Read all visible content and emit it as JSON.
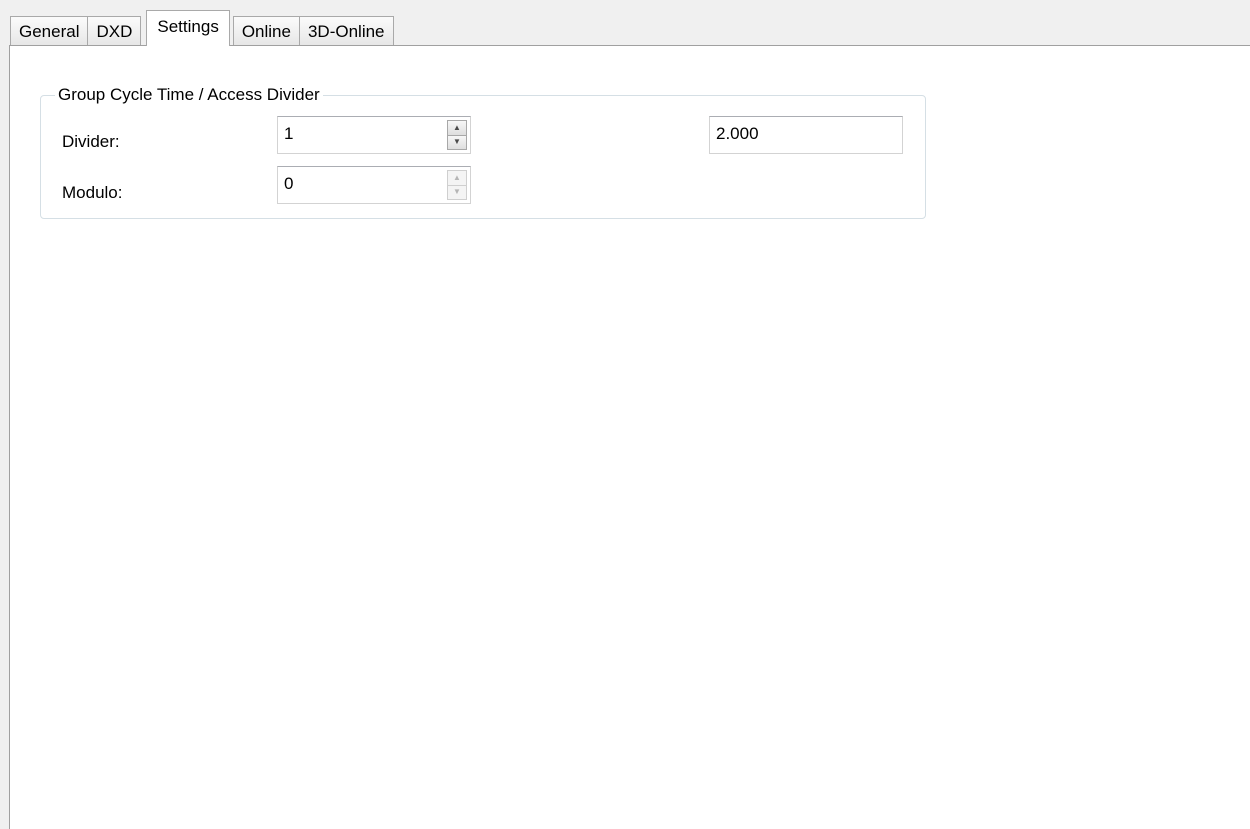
{
  "tabs": [
    {
      "label": "General",
      "active": false
    },
    {
      "label": "DXD",
      "active": false
    },
    {
      "label": "Settings",
      "active": true
    },
    {
      "label": "Online",
      "active": false
    },
    {
      "label": "3D-Online",
      "active": false
    }
  ],
  "group": {
    "title": "Group Cycle Time / Access Divider",
    "divider": {
      "label": "Divider:",
      "value": "1",
      "enabled": true
    },
    "modulo": {
      "label": "Modulo:",
      "value": "0",
      "enabled": false
    },
    "cycle_time_value": "2.000"
  },
  "icons": {
    "spin_up": "spin-up-arrow-icon",
    "spin_down": "spin-down-arrow-icon"
  },
  "colors": {
    "window_bg": "#f0f0f0",
    "panel_bg": "#ffffff",
    "border": "#a0a0a0",
    "group_border": "#d5dfe5"
  }
}
